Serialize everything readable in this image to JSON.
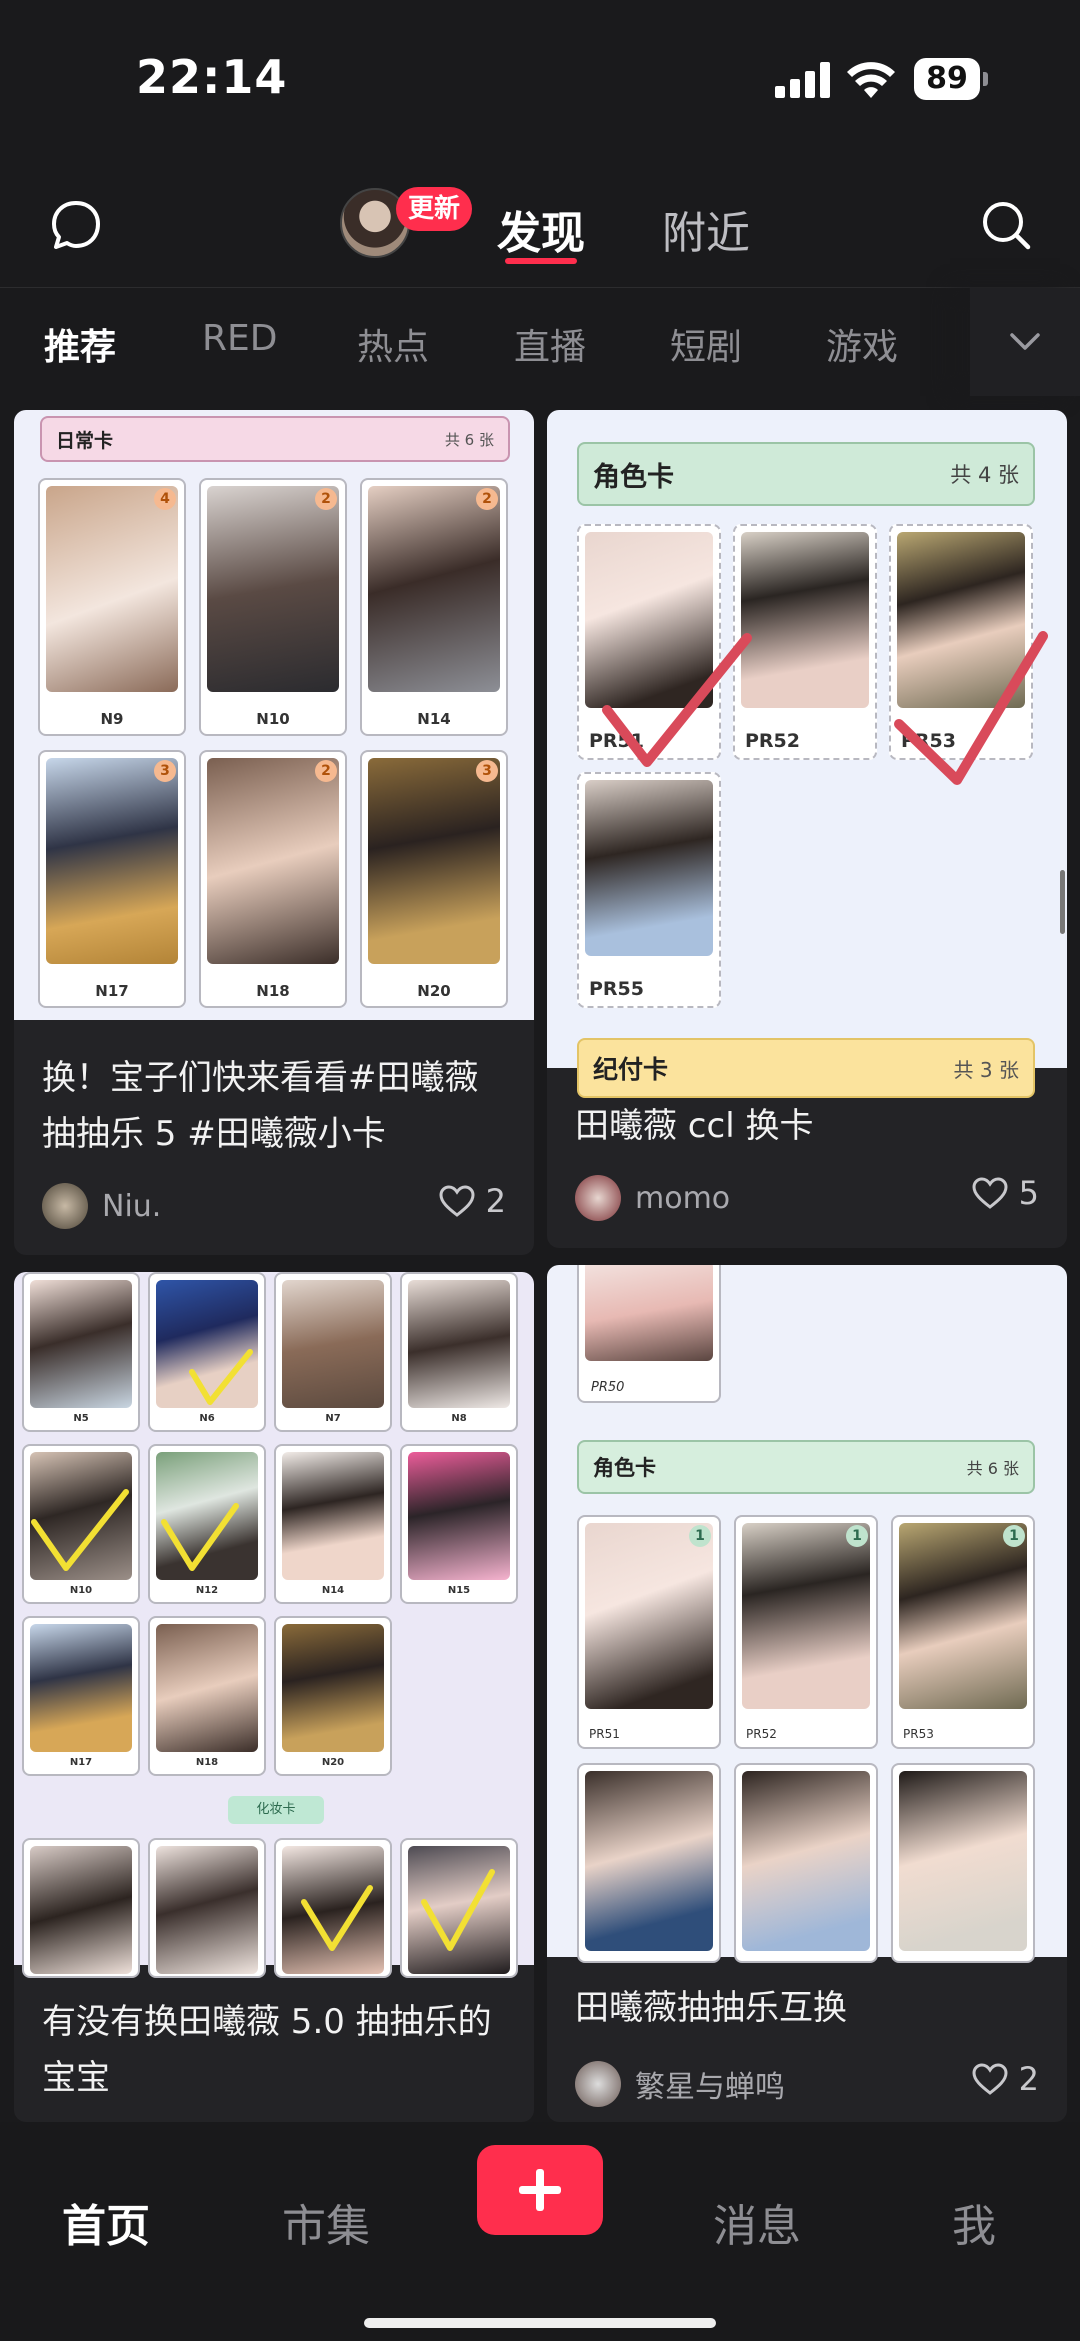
{
  "status_bar": {
    "time": "22:14",
    "battery": "89"
  },
  "top_nav": {
    "update_badge": "更新",
    "tabs": [
      {
        "label": "发现",
        "active": true
      },
      {
        "label": "附近",
        "active": false
      }
    ]
  },
  "channels": {
    "items": [
      {
        "label": "推荐",
        "active": true
      },
      {
        "label": "RED"
      },
      {
        "label": "热点"
      },
      {
        "label": "直播"
      },
      {
        "label": "短剧"
      },
      {
        "label": "游戏"
      }
    ]
  },
  "feed": {
    "cards": [
      {
        "title": "换！宝子们快来看看#田曦薇抽抽乐 5 #田曦薇小卡",
        "author": "Niu.",
        "likes": "2",
        "sheet": {
          "header_title": "日常卡",
          "header_count": "共 6 张",
          "cards": [
            {
              "label": "N9",
              "count": "4"
            },
            {
              "label": "N10",
              "count": "2"
            },
            {
              "label": "N14",
              "count": "2"
            },
            {
              "label": "N17",
              "count": "3"
            },
            {
              "label": "N18",
              "count": "2"
            },
            {
              "label": "N20",
              "count": "3"
            }
          ]
        }
      },
      {
        "title": "田曦薇 ccl 换卡",
        "author": "momo",
        "likes": "5",
        "sheet": {
          "header_title": "角色卡",
          "header_count": "共 4 张",
          "cards": [
            {
              "label": "PR51"
            },
            {
              "label": "PR52"
            },
            {
              "label": "PR53"
            },
            {
              "label": "PR55"
            }
          ],
          "next_header_title": "纪付卡",
          "next_header_count": "共 3 张"
        }
      },
      {
        "title": "有没有换田曦薇 5.0 抽抽乐的宝宝",
        "sheet": {
          "rows": [
            [
              {
                "label": "N5"
              },
              {
                "label": "N6"
              },
              {
                "label": "N7"
              },
              {
                "label": "N8"
              }
            ],
            [
              {
                "label": "N10"
              },
              {
                "label": "N12"
              },
              {
                "label": "N14"
              },
              {
                "label": "N15"
              }
            ],
            [
              {
                "label": "N17"
              },
              {
                "label": "N18"
              },
              {
                "label": "N20"
              }
            ]
          ],
          "divider_label": "化妆卡"
        }
      },
      {
        "title": "田曦薇抽抽乐互换",
        "author": "繁星与蝉鸣",
        "likes": "2",
        "sheet": {
          "top_label": "PR50",
          "header_title": "角色卡",
          "header_count": "共 6 张",
          "cards": [
            {
              "label": "PR51",
              "count": "1"
            },
            {
              "label": "PR52",
              "count": "1"
            },
            {
              "label": "PR53",
              "count": "1"
            }
          ]
        }
      }
    ]
  },
  "bottom_nav": {
    "items": [
      {
        "label": "首页",
        "active": true
      },
      {
        "label": "市集"
      },
      {
        "label": "消息"
      },
      {
        "label": "我"
      }
    ]
  },
  "colors": {
    "accent": "#ff2e4d",
    "background": "#1a1a1c",
    "card": "#232326"
  }
}
